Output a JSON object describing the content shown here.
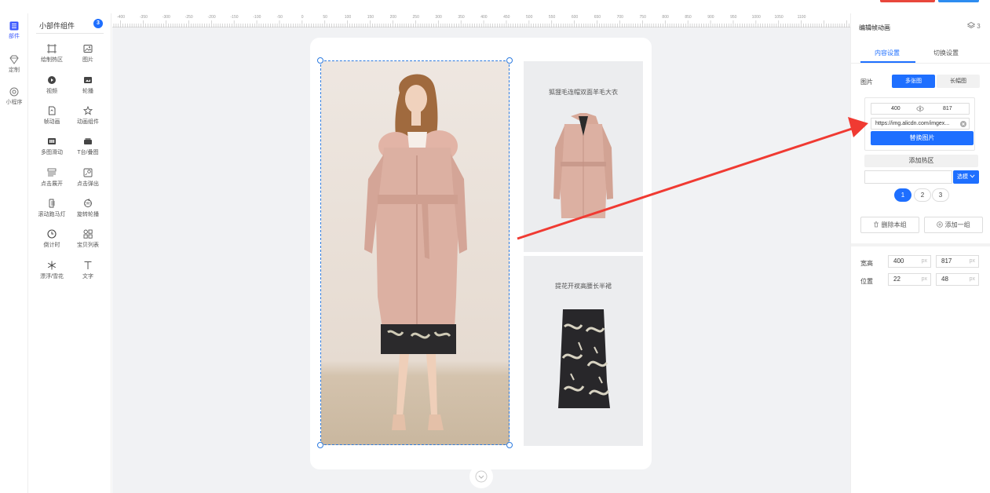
{
  "rail": {
    "items": [
      {
        "label": "部件",
        "icon": "list-icon",
        "active": true
      },
      {
        "label": "定制",
        "icon": "diamond-icon",
        "active": false
      },
      {
        "label": "小程序",
        "icon": "miniapp-icon",
        "active": false
      }
    ]
  },
  "widgets": {
    "title": "小部件组件",
    "badge": "3",
    "items": [
      {
        "label": "绘制热区",
        "icon": "hotzone-icon"
      },
      {
        "label": "图片",
        "icon": "image-icon"
      },
      {
        "label": "视频",
        "icon": "video-icon"
      },
      {
        "label": "轮播",
        "icon": "carousel-icon"
      },
      {
        "label": "帧动画",
        "icon": "frame-animation-icon"
      },
      {
        "label": "动画组件",
        "icon": "star-animation-icon"
      },
      {
        "label": "多图滑动",
        "icon": "multi-image-slide-icon"
      },
      {
        "label": "T台/叠图",
        "icon": "runway-stack-icon"
      },
      {
        "label": "点击展开",
        "icon": "click-expand-icon"
      },
      {
        "label": "点击弹出",
        "icon": "click-popup-icon"
      },
      {
        "label": "滚动跑马灯",
        "icon": "marquee-icon"
      },
      {
        "label": "旋转轮播",
        "icon": "rotate-carousel-icon"
      },
      {
        "label": "倒计时",
        "icon": "clock-icon"
      },
      {
        "label": "宝贝列表",
        "icon": "grid-list-icon"
      },
      {
        "label": "漂浮/雪花",
        "icon": "snowflake-icon"
      },
      {
        "label": "文字",
        "icon": "text-icon"
      }
    ]
  },
  "ruler": {
    "ticks": [
      "-400",
      "-350",
      "-300",
      "-250",
      "-200",
      "-150",
      "-100",
      "-50",
      "0",
      "50",
      "100",
      "150",
      "200",
      "250",
      "300",
      "350",
      "400",
      "450",
      "500",
      "550",
      "600",
      "650",
      "700",
      "750",
      "800",
      "850",
      "900",
      "950",
      "1000",
      "1050",
      "1100"
    ]
  },
  "canvas": {
    "tile_top_caption": "狐狸毛连帽双面羊毛大衣",
    "tile_bottom_caption": "提花开衩高腰长半裙"
  },
  "panel": {
    "title": "编辑帧动画",
    "layers_count": "3",
    "tabs": {
      "content": "内容设置",
      "switch": "切换设置"
    },
    "image_label": "图片",
    "mode_multi": "多张图",
    "mode_long": "长幅图",
    "img_width": "400",
    "img_height": "817",
    "url": "https://img.alicdn.com/imgex...",
    "replace_label": "替换图片",
    "add_hotzone_label": "添加热区",
    "select_label": "选模",
    "pages": [
      "1",
      "2",
      "3"
    ],
    "delete_group_label": "删除本组",
    "add_group_label": "添加一组",
    "size_label": "宽高",
    "position_label": "位置",
    "unit": "px",
    "width": "400",
    "height": "817",
    "pos_x": "22",
    "pos_y": "48"
  },
  "colors": {
    "accent": "#1e6fff",
    "annotation_arrow": "#f03a32",
    "canvas_bg": "#f1f2f4"
  }
}
